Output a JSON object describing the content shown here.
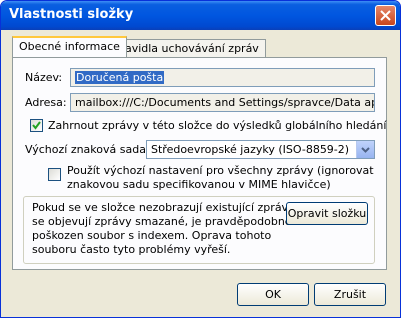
{
  "window": {
    "title": "Vlastnosti složky"
  },
  "tabs": [
    {
      "label": "Obecné informace"
    },
    {
      "label": "Pravidla uchovávání zpráv"
    }
  ],
  "general": {
    "name_label": "Název:",
    "name_value": "Doručená pošta",
    "address_label": "Adresa:",
    "address_value": "mailbox:///C:/Documents and Settings/spravce/Data aplikací",
    "include_global_search_label": "Zahrnout zprávy v této složce do výsledků globálního hledání",
    "include_global_search_checked": true,
    "charset_label": "Výchozí znaková sada:",
    "charset_value": "Středoevropské jazyky (ISO-8859-2)",
    "override_charset_line1": "Použít výchozí nastavení pro všechny zprávy (ignorovat",
    "override_charset_line2": "znakovou sadu specifikovanou v MIME hlavičce)",
    "override_charset_checked": false,
    "repair_info_lines": [
      "Pokud se ve složce nezobrazují existující zprávy či",
      "se objevují zprávy smazané, je pravděpodobně",
      "poškozen soubor s indexem. Oprava tohoto",
      "souboru často tyto problémy vyřeší."
    ],
    "repair_button": "Opravit složku"
  },
  "buttons": {
    "ok": "OK",
    "cancel": "Zrušit"
  }
}
